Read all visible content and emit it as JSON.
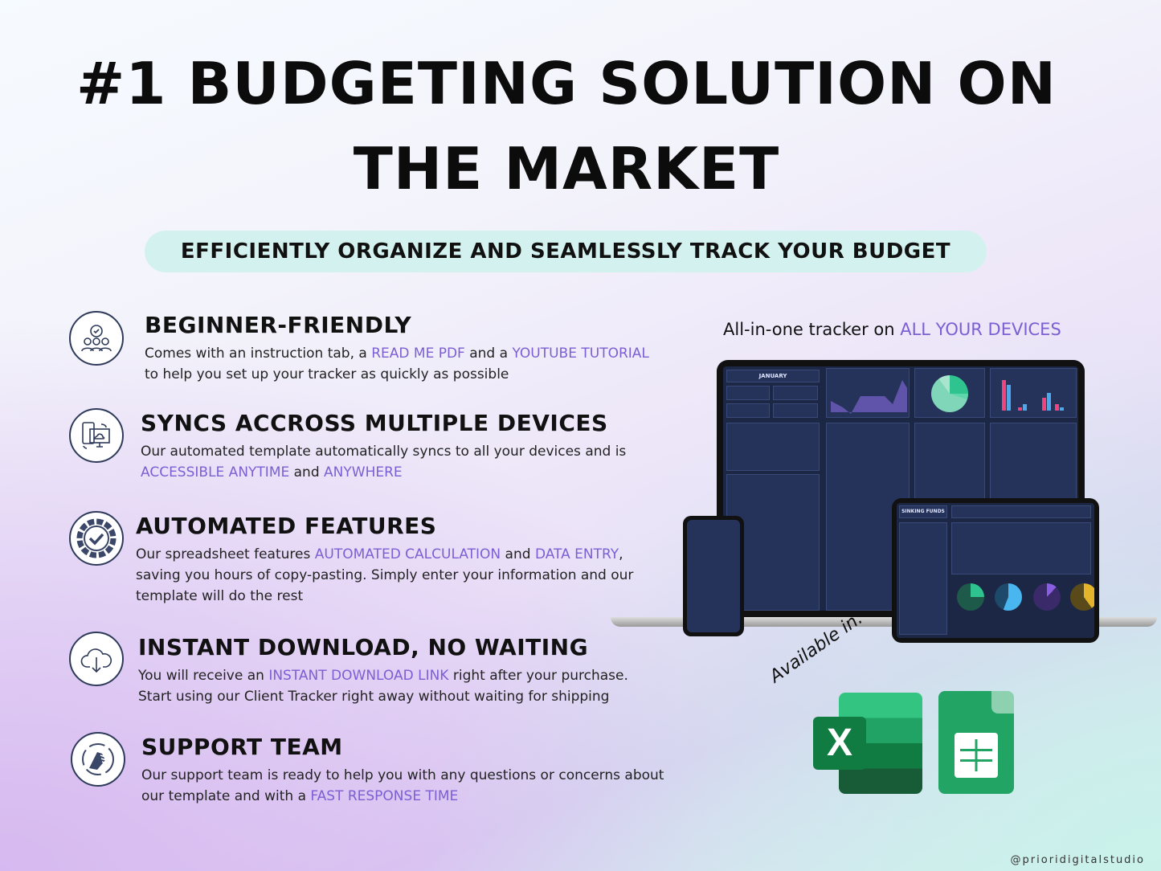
{
  "title": {
    "line1": "#1 BUDGETING SOLUTION ON",
    "line2": "THE MARKET"
  },
  "subtitle": "EFFICIENTLY ORGANIZE AND SEAMLESSLY TRACK YOUR BUDGET",
  "accent_color": "#7b5fd3",
  "features": [
    {
      "icon": "team-gear-icon",
      "heading": "BEGINNER-FRIENDLY",
      "p": [
        "Comes with an instruction tab, a ",
        "READ ME PDF",
        " and a ",
        "YOUTUBE TUTORIAL",
        "to help you set up your tracker as quickly as possible"
      ]
    },
    {
      "icon": "devices-sync-icon",
      "heading": "SYNCS ACCROSS MULTIPLE DEVICES",
      "p": [
        "Our automated template automatically syncs to all your devices and is",
        "ACCESSIBLE ANYTIME",
        " and ",
        "ANYWHERE"
      ]
    },
    {
      "icon": "gear-check-icon",
      "heading": "AUTOMATED FEATURES",
      "p": [
        "Our spreadsheet features ",
        "AUTOMATED CALCULATION",
        " and ",
        "DATA ENTRY",
        ",",
        "saving you hours of copy-pasting. Simply enter your information and our",
        "template will do the rest"
      ]
    },
    {
      "icon": "cloud-download-icon",
      "heading": "INSTANT DOWNLOAD, NO WAITING",
      "p": [
        "You will receive an ",
        "INSTANT DOWNLOAD LINK",
        " right after your purchase.",
        "Start using our Client Tracker right away without waiting for shipping"
      ]
    },
    {
      "icon": "handshake-icon",
      "heading": "SUPPORT TEAM",
      "p": [
        "Our support team is ready to help you with any questions or concerns about",
        "our template and with a ",
        "FAST RESPONSE TIME"
      ]
    }
  ],
  "devices": {
    "caption": "All-in-one tracker on ",
    "caption_hl": "ALL YOUR DEVICES",
    "laptop_title": "JANUARY",
    "tablet_title": "SINKING FUNDS"
  },
  "available": {
    "label": "Available in:",
    "apps": [
      "excel-icon",
      "google-sheets-icon"
    ]
  },
  "handle": "@prioridigitalstudio"
}
